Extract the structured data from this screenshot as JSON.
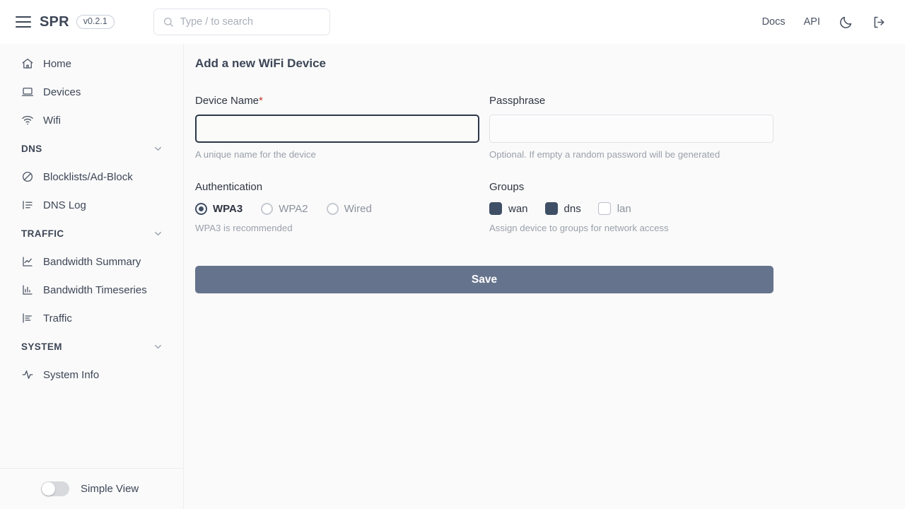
{
  "header": {
    "menu_icon": "hamburger-icon",
    "brand": "SPR",
    "version": "v0.2.1",
    "search": {
      "value": "",
      "placeholder": "Type / to search",
      "icon": "search-icon"
    },
    "docs_label": "Docs",
    "api_label": "API",
    "theme_icon": "moon-icon",
    "logout_icon": "logout-icon"
  },
  "sidebar": {
    "items": [
      {
        "label": "Home",
        "icon": "home-icon",
        "type": "item"
      },
      {
        "label": "Devices",
        "icon": "laptop-icon",
        "type": "item"
      },
      {
        "label": "Wifi",
        "icon": "wifi-icon",
        "type": "item"
      },
      {
        "label": "DNS",
        "icon": "chevron-down-icon",
        "type": "section"
      },
      {
        "label": "Blocklists/Ad-Block",
        "icon": "ban-icon",
        "type": "item"
      },
      {
        "label": "DNS Log",
        "icon": "list-icon",
        "type": "item"
      },
      {
        "label": "TRAFFIC",
        "icon": "chevron-down-icon",
        "type": "section"
      },
      {
        "label": "Bandwidth Summary",
        "icon": "line-chart-icon",
        "type": "item"
      },
      {
        "label": "Bandwidth Timeseries",
        "icon": "bar-chart-icon",
        "type": "item"
      },
      {
        "label": "Traffic",
        "icon": "hbar-chart-icon",
        "type": "item"
      },
      {
        "label": "SYSTEM",
        "icon": "chevron-down-icon",
        "type": "section"
      },
      {
        "label": "System Info",
        "icon": "activity-icon",
        "type": "item"
      }
    ],
    "footer": {
      "toggle_label": "Simple View",
      "toggle_on": false
    }
  },
  "main": {
    "title": "Add a new WiFi Device",
    "device_name": {
      "label": "Device Name",
      "required_marker": "*",
      "value": "",
      "placeholder": "",
      "hint": "A unique name for the device",
      "focused": true
    },
    "passphrase": {
      "label": "Passphrase",
      "value": "",
      "placeholder": "",
      "hint": "Optional. If empty a random password will be generated"
    },
    "authentication": {
      "label": "Authentication",
      "hint": "WPA3 is recommended",
      "selected": "WPA3",
      "options": [
        {
          "label": "WPA3",
          "checked": true
        },
        {
          "label": "WPA2",
          "checked": false
        },
        {
          "label": "Wired",
          "checked": false
        }
      ]
    },
    "groups": {
      "label": "Groups",
      "hint": "Assign device to groups for network access",
      "options": [
        {
          "label": "wan",
          "checked": true
        },
        {
          "label": "dns",
          "checked": true
        },
        {
          "label": "lan",
          "checked": false
        }
      ]
    },
    "save_label": "Save"
  },
  "colors": {
    "accent": "#3f4f66",
    "button": "#66738c",
    "text": "#3d4657",
    "muted": "#9aa0ab",
    "required": "#c0392b",
    "sidebar_bg": "#fafafa"
  }
}
